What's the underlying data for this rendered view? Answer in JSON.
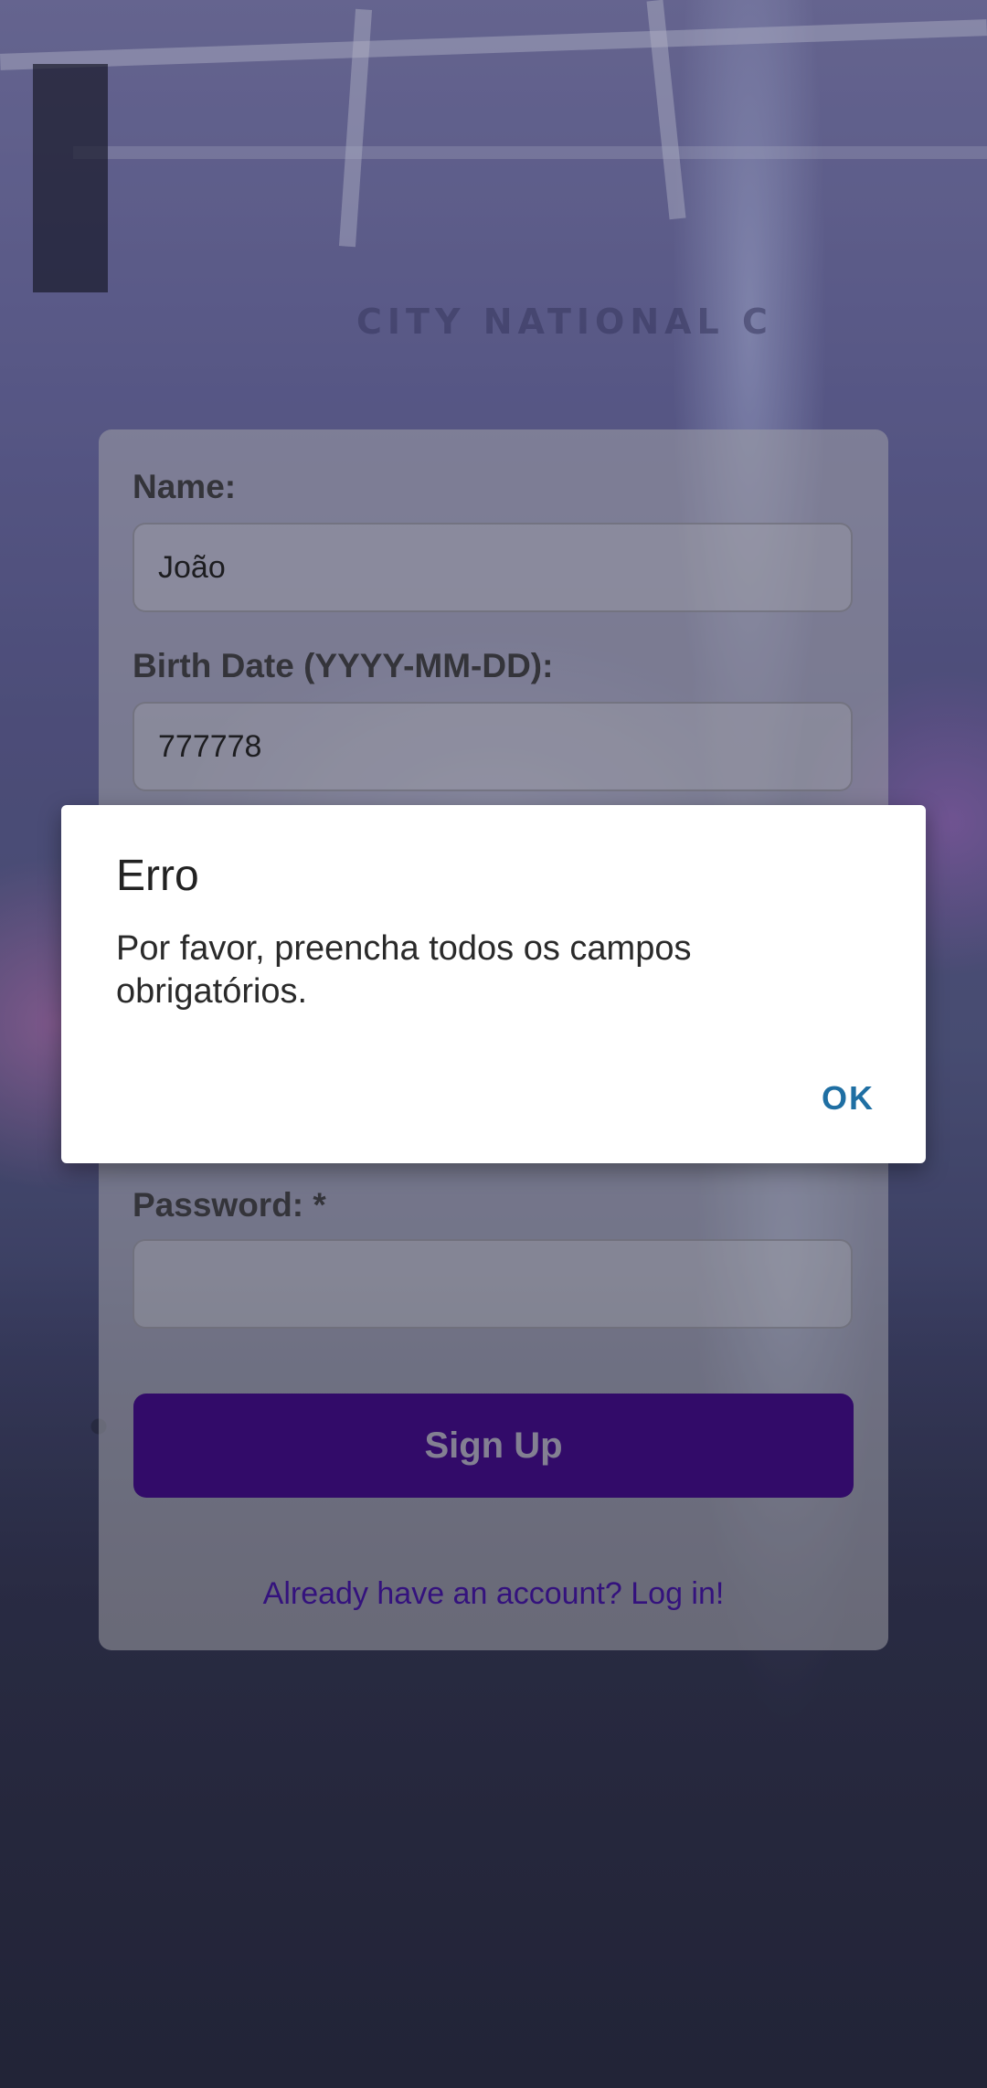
{
  "background": {
    "arena_sign_text": "CITY NATIONAL C"
  },
  "form": {
    "name_label": "Name:",
    "name_value": "João",
    "birth_label": "Birth Date (YYYY-MM-DD):",
    "birth_value": "777778",
    "password_label": "Password: *",
    "password_value": "",
    "signup_label": "Sign Up",
    "login_link": "Already have an account? Log in!"
  },
  "dialog": {
    "title": "Erro",
    "message": "Por favor, preencha todos os campos obrigatórios.",
    "ok_label": "OK"
  },
  "colors": {
    "primary_button": "#37007f",
    "link": "#3a0a9a",
    "dialog_action": "#1f6fa3"
  }
}
